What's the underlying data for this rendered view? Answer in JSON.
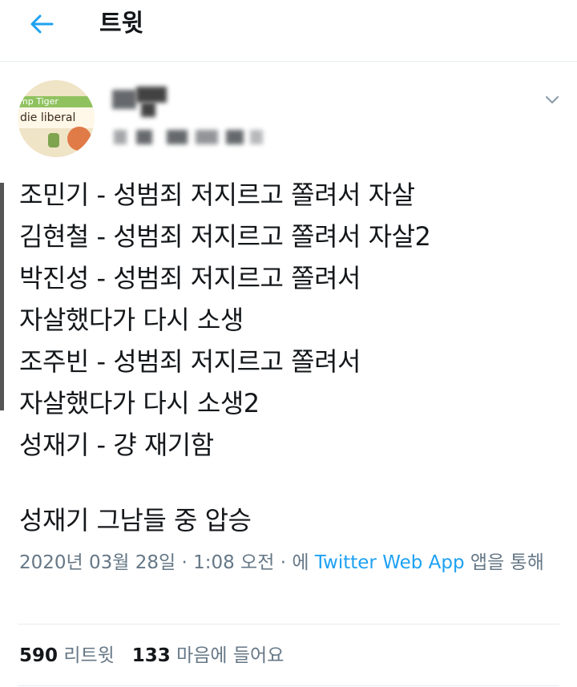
{
  "header": {
    "title": "트윗",
    "back_icon": "back-arrow-icon"
  },
  "author": {
    "avatar": {
      "line1": "mp Tiger",
      "line2": "die liberal"
    }
  },
  "tweet": {
    "lines": [
      "조민기 - 성범죄 저지르고 쫄려서 자살",
      "김현철 - 성범죄 저지르고 쫄려서 자살2",
      "박진성 - 성범죄 저지르고 쫄려서",
      "자살했다가 다시 소생",
      "조주빈 - 성범죄 저지르고 쫄려서",
      "자살했다가 다시 소생2",
      "성재기 - 걍 재기함"
    ],
    "extra": "성재기 그남들 중 압승"
  },
  "meta": {
    "datetime": "2020년 03월 28일 · 1:08 오전 · 에 ",
    "source": "Twitter Web App",
    "suffix": " 앱을 통해"
  },
  "stats": {
    "retweets": "590",
    "retweets_label": "리트윗",
    "likes": "133",
    "likes_label": "마음에 들어요"
  },
  "colors": {
    "link": "#1da1f2",
    "muted": "#657786",
    "text": "#14171a"
  }
}
